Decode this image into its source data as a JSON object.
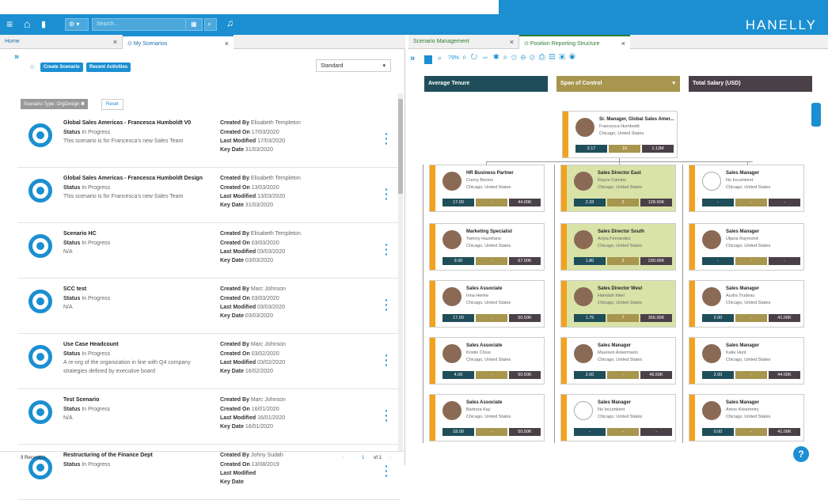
{
  "topbar": {
    "search_placeholder": "Search...",
    "brand": "HANELLY"
  },
  "left_tabs": [
    {
      "label": "Home"
    },
    {
      "label": "My Scenarios"
    }
  ],
  "left": {
    "create_label": "Create Scenario",
    "recent_label": "Recent Activities",
    "standard_value": "Standard",
    "filter_label": "Scenario Type: OrgDesign",
    "reset_label": "Reset",
    "records": "9 Record(s)",
    "page": "1",
    "of": "of 1"
  },
  "scenarios": [
    {
      "title": "Global Sales Americas - Francesca Humboldt V0",
      "status": "In Progress",
      "desc": "This scenario is for Francesca's new Sales Team",
      "desc2": "",
      "created_by": "Elisabeth Templeton",
      "created_on": "17/03/2020",
      "last_modified": "17/03/2020",
      "key_date": "31/03/2020"
    },
    {
      "title": "Global Sales Americas - Francesca Humboldt Design",
      "status": "In Progress",
      "desc": "This scenario is for Francesca's new Sales Team",
      "desc2": "",
      "created_by": "Elisabeth Templeton",
      "created_on": "13/03/2020",
      "last_modified": "13/03/2020",
      "key_date": "31/03/2020"
    },
    {
      "title": "Scenario HC",
      "status": "In Progress",
      "desc": "N/A",
      "desc2": "",
      "created_by": "Elisabeth Templeton",
      "created_on": "03/03/2020",
      "last_modified": "03/03/2020",
      "key_date": "03/03/2020"
    },
    {
      "title": "SCC test",
      "status": "In Progress",
      "desc": "N/A",
      "desc2": "",
      "created_by": "Marc Johnson",
      "created_on": "03/03/2020",
      "last_modified": "03/03/2020",
      "key_date": "03/03/2020"
    },
    {
      "title": "Use Case Headcount",
      "status": "In Progress",
      "desc": "A re-org of the organization in line with Q4 company",
      "desc2": "strategies defined by executive board",
      "created_by": "Marc Johnson",
      "created_on": "03/02/2020",
      "last_modified": "03/02/2020",
      "key_date": "16/02/2020"
    },
    {
      "title": "Test Scenario",
      "status": "In Progress",
      "desc": "N/A",
      "desc2": "",
      "created_by": "Marc Johnson",
      "created_on": "16/01/2020",
      "last_modified": "16/01/2020",
      "key_date": "16/01/2020"
    },
    {
      "title": "Restructuring of the Finance Dept",
      "status": "In Progress",
      "desc": "",
      "desc2": "",
      "created_by": "Johny Sudah",
      "created_on": "13/08/2019",
      "last_modified": "",
      "key_date": ""
    }
  ],
  "labels": {
    "status": "Status",
    "created_by": "Created By",
    "created_on": "Created On",
    "last_modified": "Last Modified",
    "key_date": "Key Date"
  },
  "right_tabs": [
    {
      "label": "Scenario Management"
    },
    {
      "label": "Position Reporting Structure"
    }
  ],
  "zoom": "79%",
  "headers": {
    "avg_tenure": "Average Tenure",
    "span": "Span of Control",
    "salary": "Total Salary (USD)"
  },
  "cards": [
    {
      "title": "Sr. Manager, Global Sales Amer...",
      "name": "Francesca Humboldt",
      "loc": "Chicago, United States",
      "m1": "3.17",
      "m2": "10",
      "m3": "1.13M"
    },
    {
      "title": "HR Business Partner",
      "name": "Conny Bevins",
      "loc": "Chicago, United States",
      "m1": "17.00",
      "m2": "-",
      "m3": "44.00K"
    },
    {
      "title": "Marketing Specialist",
      "name": "Tammy Hazeltane",
      "loc": "Chicago, United States",
      "m1": "9.00",
      "m2": "-",
      "m3": "67.00K"
    },
    {
      "title": "Sales Associate",
      "name": "Irina Henke",
      "loc": "Chicago, United States",
      "m1": "17.00",
      "m2": "-",
      "m3": "50.50K"
    },
    {
      "title": "Sales Associate",
      "name": "Kristin Cloux",
      "loc": "Chicago, United States",
      "m1": "4.00",
      "m2": "-",
      "m3": "50.50K"
    },
    {
      "title": "Sales Associate",
      "name": "Barbora Kay",
      "loc": "Chicago, United States",
      "m1": "18.00",
      "m2": "-",
      "m3": "50.50K"
    },
    {
      "title": "Sales Director East",
      "name": "Royce Camino",
      "loc": "Chicago, United States",
      "m1": "2.33",
      "m2": "2",
      "m3": "128.50K"
    },
    {
      "title": "Sales Director South",
      "name": "Ariyia Fernandez",
      "loc": "Chicago, United States",
      "m1": "1.80",
      "m2": "3",
      "m3": "230.00K"
    },
    {
      "title": "Sales Director West",
      "name": "Hamdah Inkel",
      "loc": "Chicago, United States",
      "m1": "1.75",
      "m2": "7",
      "m3": "356.00K"
    },
    {
      "title": "Sales Manager",
      "name": "Maureen Ackermann",
      "loc": "Chicago, United States",
      "m1": "2.00",
      "m2": "-",
      "m3": "46.50K"
    },
    {
      "title": "Sales Manager",
      "name": "No Incumbent",
      "loc": "Chicago, United States",
      "m1": "-",
      "m2": "-",
      "m3": "-"
    },
    {
      "title": "Sales Manager",
      "name": "No Incumbent",
      "loc": "Chicago, United States",
      "m1": "-",
      "m2": "-",
      "m3": "-"
    },
    {
      "title": "Sales Manager",
      "name": "Uljana Raymond",
      "loc": "Chicago, United States",
      "m1": "-",
      "m2": "-",
      "m3": "-"
    },
    {
      "title": "Sales Manager",
      "name": "Audra Trudeau",
      "loc": "Chicago, United States",
      "m1": "2.00",
      "m2": "-",
      "m3": "41.00K"
    },
    {
      "title": "Sales Manager",
      "name": "Katie Hunt",
      "loc": "Chicago, United States",
      "m1": "2.00",
      "m2": "-",
      "m3": "44.00K"
    },
    {
      "title": "Sales Manager",
      "name": "Amos Kitsemetry",
      "loc": "Chicago, United States",
      "m1": "0.00",
      "m2": "-",
      "m3": "41.00K"
    }
  ],
  "colors": {
    "brand": "#1b8fd1",
    "tenure": "#1f4e5a",
    "span": "#a8954e",
    "salary": "#4a4047",
    "accent": "#f2a21d"
  }
}
